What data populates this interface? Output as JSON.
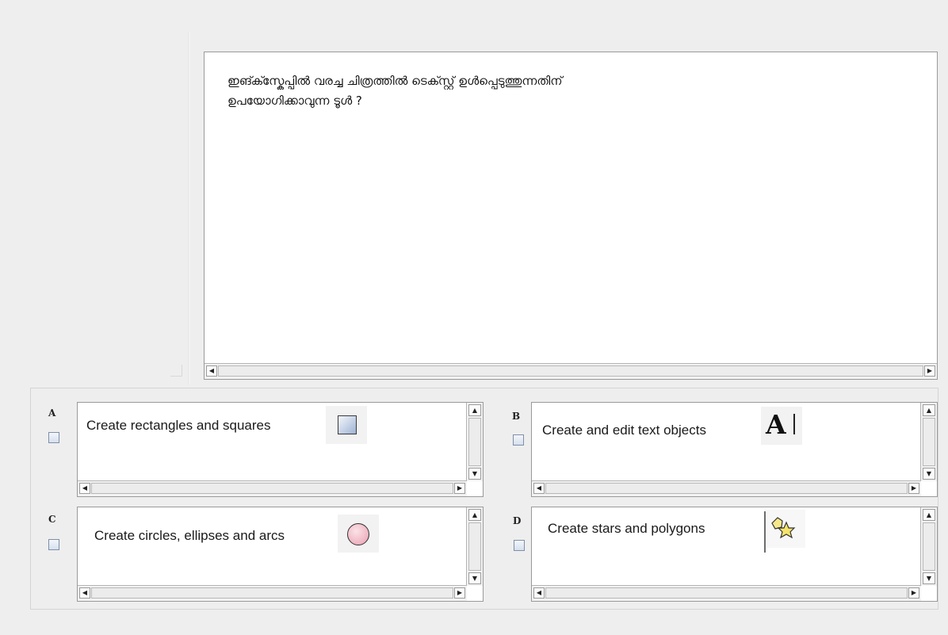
{
  "question": {
    "text": "ഇങ്ക്സ്കേപ്പിൽ വരച്ച  ചിത്രത്തിൽ ടെക്സ്റ്റ് ഉൾപ്പെടുത്തുന്നതിന്\nഉപയോഗിക്കാവുന്ന ടൂൾ ?"
  },
  "options": [
    {
      "letter": "A",
      "text": "Create rectangles and squares",
      "icon": "rectangle-tool-icon"
    },
    {
      "letter": "B",
      "text": "Create and edit text objects",
      "icon": "text-tool-icon"
    },
    {
      "letter": "C",
      "text": "Create circles, ellipses and arcs",
      "icon": "ellipse-tool-icon"
    },
    {
      "letter": "D",
      "text": "Create stars and polygons",
      "icon": "star-polygon-tool-icon"
    }
  ],
  "icons": {
    "text_tool_glyph": "A",
    "scroll_left": "◀",
    "scroll_right": "▶",
    "scroll_up": "▲",
    "scroll_down": "▼"
  }
}
